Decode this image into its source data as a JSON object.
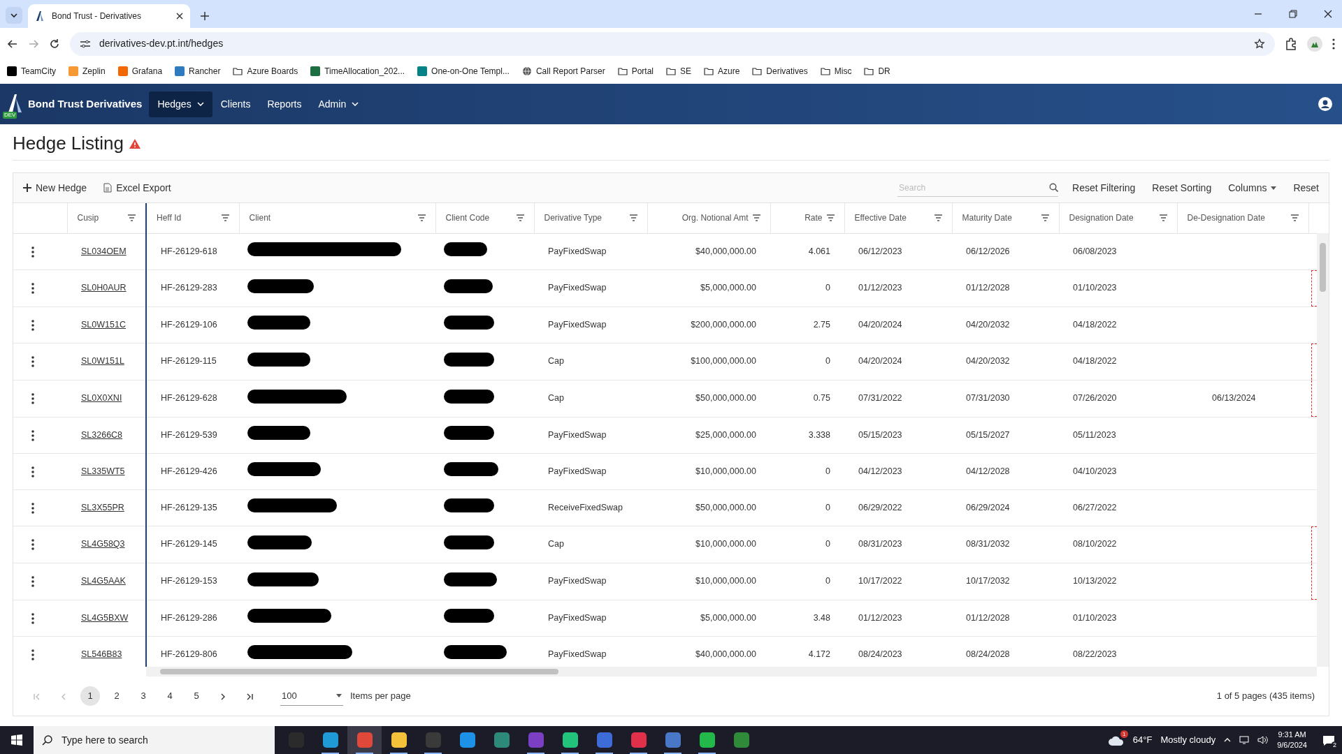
{
  "browser": {
    "tab": {
      "title": "Bond Trust - Derivatives"
    },
    "url": "derivatives-dev.pt.int/hedges",
    "bookmarks": [
      {
        "label": "TeamCity",
        "kind": "app",
        "color": "#000000"
      },
      {
        "label": "Zeplin",
        "kind": "app",
        "color": "#f69833"
      },
      {
        "label": "Grafana",
        "kind": "app",
        "color": "#f46800"
      },
      {
        "label": "Rancher",
        "kind": "app",
        "color": "#2f7bbf"
      },
      {
        "label": "Azure Boards",
        "kind": "folder"
      },
      {
        "label": "TimeAllocation_202...",
        "kind": "app",
        "color": "#1d6f42"
      },
      {
        "label": "One-on-One Templ...",
        "kind": "app",
        "color": "#038387"
      },
      {
        "label": "Call Report Parser",
        "kind": "globe"
      },
      {
        "label": "Portal",
        "kind": "folder"
      },
      {
        "label": "SE",
        "kind": "folder"
      },
      {
        "label": "Azure",
        "kind": "folder"
      },
      {
        "label": "Derivatives",
        "kind": "folder"
      },
      {
        "label": "Misc",
        "kind": "folder"
      },
      {
        "label": "DR",
        "kind": "folder"
      }
    ]
  },
  "navbar": {
    "brand": "Bond Trust Derivatives",
    "env": "DEV",
    "items": [
      {
        "label": "Hedges",
        "selected": true,
        "dropdown": true
      },
      {
        "label": "Clients",
        "selected": false,
        "dropdown": false
      },
      {
        "label": "Reports",
        "selected": false,
        "dropdown": false
      },
      {
        "label": "Admin",
        "selected": false,
        "dropdown": true
      }
    ]
  },
  "page": {
    "title": "Hedge Listing",
    "warning": true
  },
  "toolbar": {
    "actions": [
      {
        "label": "New Hedge",
        "kind": "add"
      },
      {
        "label": "Excel Export",
        "kind": "export"
      }
    ],
    "search": {
      "placeholder": "Search"
    },
    "buttons": [
      {
        "label": "Reset Filtering",
        "dropdown": false
      },
      {
        "label": "Reset Sorting",
        "dropdown": false
      },
      {
        "label": "Columns",
        "dropdown": true
      },
      {
        "label": "Reset",
        "dropdown": false
      }
    ]
  },
  "table": {
    "columns": [
      "Cusip",
      "Heff Id",
      "Client",
      "Client Code",
      "Derivative Type",
      "Org. Notional Amt",
      "Rate",
      "Effective Date",
      "Maturity Date",
      "Designation Date",
      "De-Designation Date"
    ],
    "rows": [
      {
        "cusip": "SL034OEM",
        "heff_id": "HF-26129-618",
        "client_redacted": true,
        "client_code_redacted": true,
        "derivative_type": "PayFixedSwap",
        "notional": "$40,000,000.00",
        "rate": "4.061",
        "effective": "06/12/2023",
        "maturity": "06/12/2026",
        "designation": "06/08/2023",
        "flagged": false
      },
      {
        "cusip": "SL0H0AUR",
        "heff_id": "HF-26129-283",
        "client_redacted": true,
        "client_code_redacted": true,
        "derivative_type": "PayFixedSwap",
        "notional": "$5,000,000.00",
        "rate": "0",
        "effective": "01/12/2023",
        "maturity": "01/12/2028",
        "designation": "01/10/2023",
        "flagged": true
      },
      {
        "cusip": "SL0W151C",
        "heff_id": "HF-26129-106",
        "client_redacted": true,
        "client_code_redacted": true,
        "derivative_type": "PayFixedSwap",
        "notional": "$200,000,000.00",
        "rate": "2.75",
        "effective": "04/20/2024",
        "maturity": "04/20/2032",
        "designation": "04/18/2022",
        "flagged": false
      },
      {
        "cusip": "SL0W151L",
        "heff_id": "HF-26129-115",
        "client_redacted": true,
        "client_code_redacted": true,
        "derivative_type": "Cap",
        "notional": "$100,000,000.00",
        "rate": "0",
        "effective": "04/20/2024",
        "maturity": "04/20/2032",
        "designation": "04/18/2022",
        "flagged": true
      },
      {
        "cusip": "SL0X0XNI",
        "heff_id": "HF-26129-628",
        "client_redacted": true,
        "client_code_redacted": true,
        "derivative_type": "Cap",
        "notional": "$50,000,000.00",
        "rate": "0.75",
        "effective": "07/31/2022",
        "maturity": "07/31/2030",
        "designation": "07/26/2020",
        "de_designation": "06/13/2024",
        "flagged": true
      },
      {
        "cusip": "SL3266C8",
        "heff_id": "HF-26129-539",
        "client_redacted": true,
        "client_code_redacted": true,
        "derivative_type": "PayFixedSwap",
        "notional": "$25,000,000.00",
        "rate": "3.338",
        "effective": "05/15/2023",
        "maturity": "05/15/2027",
        "designation": "05/11/2023",
        "flagged": false
      },
      {
        "cusip": "SL335WT5",
        "heff_id": "HF-26129-426",
        "client_redacted": true,
        "client_code_redacted": true,
        "derivative_type": "PayFixedSwap",
        "notional": "$10,000,000.00",
        "rate": "0",
        "effective": "04/12/2023",
        "maturity": "04/12/2028",
        "designation": "04/10/2023",
        "flagged": false
      },
      {
        "cusip": "SL3X55PR",
        "heff_id": "HF-26129-135",
        "client_redacted": true,
        "client_code_redacted": true,
        "derivative_type": "ReceiveFixedSwap",
        "notional": "$50,000,000.00",
        "rate": "0",
        "effective": "06/29/2022",
        "maturity": "06/29/2024",
        "designation": "06/27/2022",
        "flagged": false
      },
      {
        "cusip": "SL4G58Q3",
        "heff_id": "HF-26129-145",
        "client_redacted": true,
        "client_code_redacted": true,
        "derivative_type": "Cap",
        "notional": "$10,000,000.00",
        "rate": "0",
        "effective": "08/31/2023",
        "maturity": "08/31/2032",
        "designation": "08/10/2022",
        "flagged": true
      },
      {
        "cusip": "SL4G5AAK",
        "heff_id": "HF-26129-153",
        "client_redacted": true,
        "client_code_redacted": true,
        "derivative_type": "PayFixedSwap",
        "notional": "$10,000,000.00",
        "rate": "0",
        "effective": "10/17/2022",
        "maturity": "10/17/2032",
        "designation": "10/13/2022",
        "flagged": true
      },
      {
        "cusip": "SL4G5BXW",
        "heff_id": "HF-26129-286",
        "client_redacted": true,
        "client_code_redacted": true,
        "derivative_type": "PayFixedSwap",
        "notional": "$5,000,000.00",
        "rate": "3.48",
        "effective": "01/12/2023",
        "maturity": "01/12/2028",
        "designation": "01/10/2023",
        "flagged": false
      },
      {
        "cusip": "SL546B83",
        "heff_id": "HF-26129-806",
        "client_redacted": true,
        "client_code_redacted": true,
        "derivative_type": "PayFixedSwap",
        "notional": "$40,000,000.00",
        "rate": "4.172",
        "effective": "08/24/2023",
        "maturity": "08/24/2028",
        "designation": "08/22/2023",
        "flagged": false
      }
    ]
  },
  "pager": {
    "pages": [
      {
        "label": "1",
        "selected": true
      },
      {
        "label": "2",
        "selected": false
      },
      {
        "label": "3",
        "selected": false
      },
      {
        "label": "4",
        "selected": false
      },
      {
        "label": "5",
        "selected": false
      }
    ],
    "page_size": "100",
    "page_size_label": "Items per page",
    "summary": "1 of 5 pages (435 items)"
  },
  "taskbar": {
    "search_placeholder": "Type here to search",
    "apps": [
      {
        "color": "#2b2b2b",
        "open": false,
        "selected": false
      },
      {
        "color": "#1f9ad6",
        "open": true,
        "selected": false
      },
      {
        "color": "#e0483a",
        "open": true,
        "selected": true
      },
      {
        "color": "#f3c13a",
        "open": true,
        "selected": false
      },
      {
        "color": "#3a3a3a",
        "open": true,
        "selected": false
      },
      {
        "color": "#1d91e6",
        "open": false,
        "selected": false
      },
      {
        "color": "#2d8a7a",
        "open": false,
        "selected": false
      },
      {
        "color": "#7b3fc4",
        "open": true,
        "selected": false
      },
      {
        "color": "#21c47a",
        "open": true,
        "selected": false
      },
      {
        "color": "#3d6bd8",
        "open": true,
        "selected": false
      },
      {
        "color": "#e0304a",
        "open": true,
        "selected": false
      },
      {
        "color": "#4a78c8",
        "open": true,
        "selected": false
      },
      {
        "color": "#23b84a",
        "open": true,
        "selected": false
      },
      {
        "color": "#2f8a3a",
        "open": false,
        "selected": false
      }
    ],
    "weather": {
      "badge": "1",
      "temp": "64°F",
      "condition": "Mostly cloudy"
    },
    "time": "9:31 AM",
    "date": "9/6/2024",
    "notifications": "2"
  }
}
